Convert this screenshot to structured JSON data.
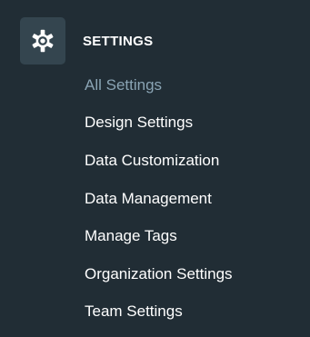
{
  "section": {
    "title": "SETTINGS",
    "icon": "gear-icon"
  },
  "menu": {
    "items": [
      {
        "label": "All Settings",
        "active": true
      },
      {
        "label": "Design Settings",
        "active": false
      },
      {
        "label": "Data Customization",
        "active": false
      },
      {
        "label": "Data Management",
        "active": false
      },
      {
        "label": "Manage Tags",
        "active": false
      },
      {
        "label": "Organization Settings",
        "active": false
      },
      {
        "label": "Team Settings",
        "active": false
      }
    ]
  },
  "colors": {
    "background": "#212d35",
    "icon_tile": "#34454f",
    "text": "#ffffff",
    "active_text": "#8aa4b4"
  }
}
